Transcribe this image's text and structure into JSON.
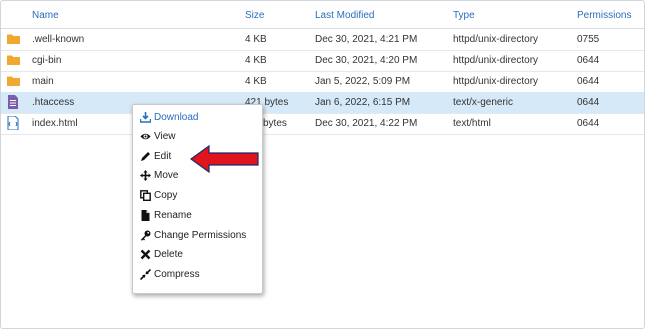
{
  "header": {
    "name": "Name",
    "size": "Size",
    "modified": "Last Modified",
    "type": "Type",
    "permissions": "Permissions"
  },
  "rows": [
    {
      "name": ".well-known",
      "size": "4 KB",
      "modified": "Dec 30, 2021, 4:21 PM",
      "type": "httpd/unix-directory",
      "permissions": "0755",
      "icon": "folder-icon"
    },
    {
      "name": "cgi-bin",
      "size": "4 KB",
      "modified": "Dec 30, 2021, 4:20 PM",
      "type": "httpd/unix-directory",
      "permissions": "0644",
      "icon": "folder-icon"
    },
    {
      "name": "main",
      "size": "4 KB",
      "modified": "Jan 5, 2022, 5:09 PM",
      "type": "httpd/unix-directory",
      "permissions": "0644",
      "icon": "folder-icon"
    },
    {
      "name": ".htaccess",
      "size": "421 bytes",
      "modified": "Jan 6, 2022, 6:15 PM",
      "type": "text/x-generic",
      "permissions": "0644",
      "icon": "text-file-icon",
      "selected": true
    },
    {
      "name": "index.html",
      "size": "bytes",
      "modified": "Dec 30, 2021, 4:22 PM",
      "type": "text/html",
      "permissions": "0644",
      "icon": "html-file-icon"
    }
  ],
  "context_menu": {
    "items": [
      {
        "label": "Download",
        "icon": "download-icon"
      },
      {
        "label": "View",
        "icon": "eye-icon"
      },
      {
        "label": "Edit",
        "icon": "pencil-icon"
      },
      {
        "label": "Move",
        "icon": "move-icon"
      },
      {
        "label": "Copy",
        "icon": "copy-icon"
      },
      {
        "label": "Rename",
        "icon": "file-icon"
      },
      {
        "label": "Change Permissions",
        "icon": "key-icon"
      },
      {
        "label": "Delete",
        "icon": "x-icon"
      },
      {
        "label": "Compress",
        "icon": "compress-icon"
      }
    ]
  },
  "colors": {
    "header_text": "#2a6ebb",
    "folder": "#f0a830",
    "file_icon": "#7b5ea7",
    "selected_row": "#d6e9f8",
    "arrow": "#e0141c"
  }
}
